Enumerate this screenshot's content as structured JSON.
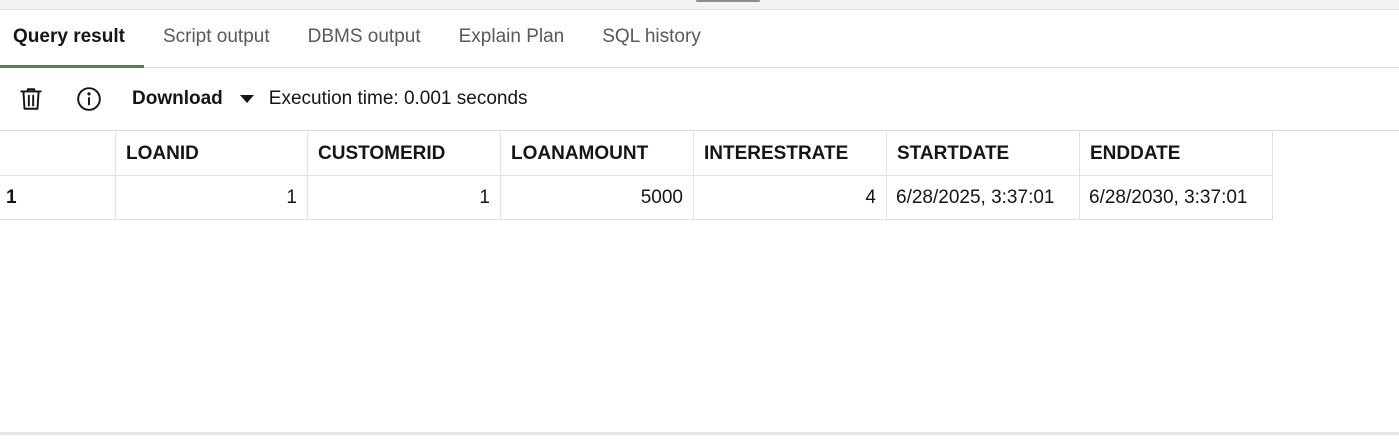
{
  "tabs": [
    {
      "label": "Query result",
      "active": true
    },
    {
      "label": "Script output",
      "active": false
    },
    {
      "label": "DBMS output",
      "active": false
    },
    {
      "label": "Explain Plan",
      "active": false
    },
    {
      "label": "SQL history",
      "active": false
    }
  ],
  "toolbar": {
    "trash_icon": "trash-icon",
    "info_icon": "info-icon",
    "download_label": "Download",
    "execution_time": "Execution time: 0.001 seconds"
  },
  "table": {
    "columns": [
      "LOANID",
      "CUSTOMERID",
      "LOANAMOUNT",
      "INTERESTRATE",
      "STARTDATE",
      "ENDDATE"
    ],
    "rows": [
      {
        "row_number": "1",
        "cells": [
          "1",
          "1",
          "5000",
          "4",
          "6/28/2025, 3:37:01",
          "6/28/2030, 3:37:01"
        ]
      }
    ]
  },
  "colors": {
    "active_tab_underline": "#4c825c",
    "border": "#dcdad8"
  }
}
